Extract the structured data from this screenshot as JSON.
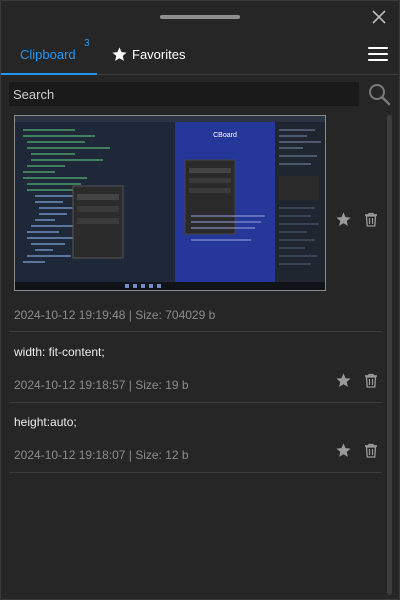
{
  "window": {
    "close_label": "×"
  },
  "tabs": [
    {
      "label": "Clipboard",
      "count": "3",
      "active": true
    },
    {
      "label": "Favorites",
      "icon": "star-icon",
      "active": false
    }
  ],
  "colors": {
    "accent": "#2196f3",
    "background": "#262626",
    "search_bg": "#1a1a1a",
    "muted_text": "#8c8c8c"
  },
  "search": {
    "placeholder": "Search",
    "value": "",
    "icon": "search-icon"
  },
  "items": [
    {
      "type": "image",
      "thumbnail_title": "CBoard",
      "meta": "2024-10-12 19:19:48 | Size: 704029 b"
    },
    {
      "type": "text",
      "content": "width: fit-content;",
      "meta": "2024-10-12 19:18:57 | Size: 19 b"
    },
    {
      "type": "text",
      "content": "height:auto;",
      "meta": "2024-10-12 19:18:07 | Size: 12 b"
    }
  ],
  "item_actions": [
    "star-icon",
    "trash-icon"
  ]
}
